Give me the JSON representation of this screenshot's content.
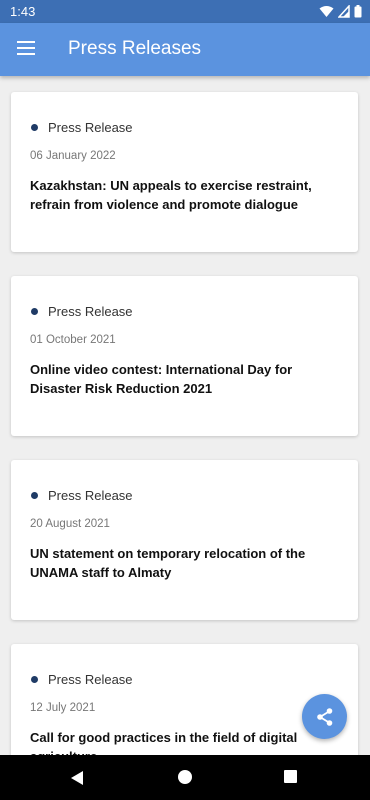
{
  "status_bar": {
    "time": "1:43",
    "icons": [
      "wifi-icon",
      "signal-icon",
      "battery-icon"
    ]
  },
  "app_bar": {
    "title": "Press Releases",
    "menu_icon": "hamburger-menu-icon"
  },
  "press_releases": [
    {
      "tag": "Press Release",
      "date": "06 January 2022",
      "title": "Kazakhstan: UN appeals to exercise restraint, refrain from violence and promote dialogue"
    },
    {
      "tag": "Press Release",
      "date": "01 October 2021",
      "title": "Online video contest: International Day for Disaster Risk Reduction 2021"
    },
    {
      "tag": "Press Release",
      "date": "20 August 2021",
      "title": "UN statement on temporary relocation of the UNAMA staff to Almaty"
    },
    {
      "tag": "Press Release",
      "date": "12 July 2021",
      "title": "Call for good practices in the field of digital agriculture"
    }
  ],
  "fab": {
    "icon": "share-icon"
  },
  "nav_bar": {
    "icons": [
      "back-icon",
      "home-icon",
      "recents-icon"
    ]
  },
  "colors": {
    "status_bar": "#3d6fb4",
    "app_bar": "#5b93df",
    "tag_dot": "#1f3b66",
    "background": "#efefef"
  }
}
